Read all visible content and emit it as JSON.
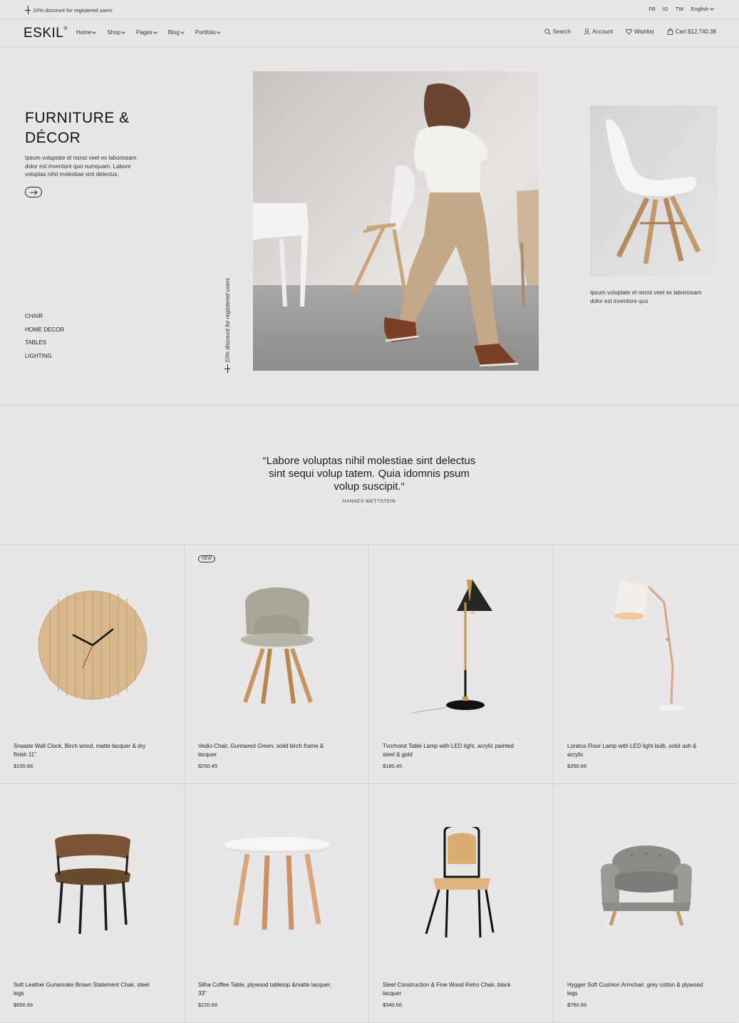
{
  "topbar": {
    "promo": "10% discount for registered users",
    "social": [
      "FB",
      "IG",
      "TW"
    ],
    "language": "English"
  },
  "header": {
    "logo": "ESKIL",
    "logo_mark": "®",
    "nav": [
      "Home",
      "Shop",
      "Pages",
      "Blog",
      "Portfolio"
    ],
    "search_label": "Search",
    "account_label": "Account",
    "wishlist_label": "Wishlist",
    "cart_label": "Cart $12,740.38"
  },
  "hero": {
    "title_line1": "FURNITURE &",
    "title_line2": "DÉCOR",
    "description": "Ipsum voluptate et nonst veet ex laboriosam dolor est inventore quo numquam. Labore voluptas nihil molestiae sint delectus.",
    "categories": [
      "CHAIR",
      "HOME DECOR",
      "TABLES",
      "LIGHTING"
    ],
    "vertical_promo": "10% discount for registered users",
    "side_description": "Ipsum voluptate et nonst veet ex laboriosam dolor est inventore quo"
  },
  "quote": {
    "text": "“Labore voluptas nihil molestiae sint delectus sint sequi volup tatem. Quia idomnis psum volup suscipit.“",
    "author": "HANNES WETTSTEIN"
  },
  "products": [
    {
      "name": "Snaade Wall Clock, Birch wood, matte lacquer & dry finish 11\"",
      "price": "$150.66",
      "badge": "",
      "icon": "wall-clock"
    },
    {
      "name": "Vedio Chair, Gunnared Green, solid birch frame & lacquer",
      "price": "$250.45",
      "badge": "NEW",
      "icon": "chair"
    },
    {
      "name": "Tvorhond Table Lamp with LED light, acrylic painted steel & gold",
      "price": "$180.45",
      "badge": "",
      "icon": "table-lamp"
    },
    {
      "name": "Loratus Floor Lamp with LED light bulb, solid ash & acrylic",
      "price": "$350.66",
      "badge": "",
      "icon": "floor-lamp"
    },
    {
      "name": "Soft Leather Gunsmoke Brown Statement Chair, steel legs",
      "price": "$650.66",
      "badge": "",
      "icon": "leather-chair"
    },
    {
      "name": "Silha Coffee Table, plywood tabletop &matte lacquer, 33\"",
      "price": "$220.66",
      "badge": "",
      "icon": "coffee-table"
    },
    {
      "name": "Steel Construction & Fine Wood Retro Chair, black lacquer",
      "price": "$340.66",
      "badge": "",
      "icon": "retro-chair"
    },
    {
      "name": "Hygger Soft Cushion Armchair, grey cotton & plywood legs",
      "price": "$760.66",
      "badge": "",
      "icon": "armchair"
    }
  ]
}
